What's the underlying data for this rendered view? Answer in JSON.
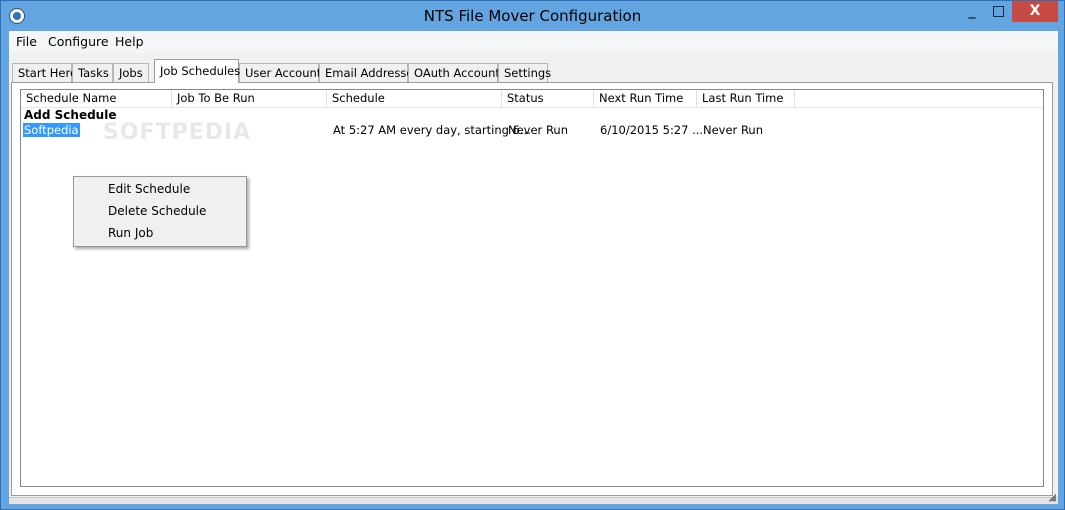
{
  "window": {
    "title": "NTS File Mover Configuration"
  },
  "controls": {
    "minimize": "_",
    "maximize": "□",
    "close": "X"
  },
  "menu": {
    "items": [
      "File",
      "Configure",
      "Help"
    ]
  },
  "tabs": [
    {
      "label": "Start Here"
    },
    {
      "label": "Tasks"
    },
    {
      "label": "Jobs"
    },
    {
      "label": "Job Schedules"
    },
    {
      "label": "User Accounts"
    },
    {
      "label": "Email Addresses"
    },
    {
      "label": "OAuth Accounts"
    },
    {
      "label": "Settings"
    }
  ],
  "activeTab": "Job Schedules",
  "list": {
    "columns": [
      "Schedule Name",
      "Job To Be Run",
      "Schedule",
      "Status",
      "Next Run Time",
      "Last Run Time"
    ],
    "add_row": "Add Schedule",
    "rows": [
      {
        "name": "Softpedia",
        "job": "",
        "schedule": "At 5:27 AM every day, starting 6...",
        "status": "Never Run",
        "next": "6/10/2015 5:27 ...",
        "last": "Never Run"
      }
    ]
  },
  "watermark": "SOFTPEDIA",
  "contextMenu": {
    "items": [
      "Edit Schedule",
      "Delete Schedule",
      "Run Job"
    ]
  },
  "colors": {
    "titlebar": "#63a5e0",
    "close": "#c74a44",
    "selection": "#3399ff"
  }
}
